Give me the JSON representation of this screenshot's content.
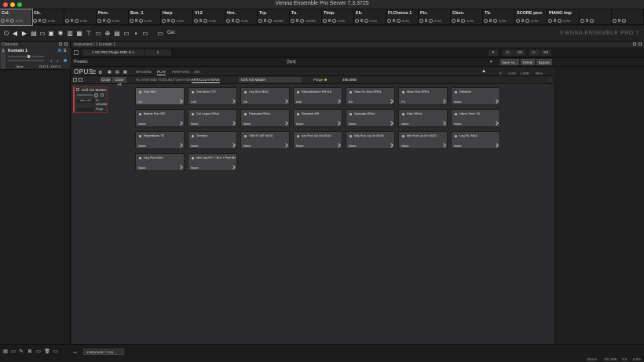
{
  "window": {
    "title": "Vienna Ensemble Pro Server 7.3.3725"
  },
  "mixer": [
    {
      "name": "Cel.",
      "val": "0.0%"
    },
    {
      "name": "Cb.",
      "val": "0.0%"
    },
    {
      "name": "",
      "val": "0.0%"
    },
    {
      "name": "Perc.",
      "val": "0.0%"
    },
    {
      "name": "Bsn. 1",
      "val": "0.0%"
    },
    {
      "name": "Harp",
      "val": "0.0%"
    },
    {
      "name": "Vl.2",
      "val": "0.0%"
    },
    {
      "name": "Hrn.",
      "val": "0.0%"
    },
    {
      "name": "Trp.",
      "val": "100/0R"
    },
    {
      "name": "Tu.",
      "val": "100/0R"
    },
    {
      "name": "Timp.",
      "val": "0.0%"
    },
    {
      "name": "Eh.",
      "val": "0.0%"
    },
    {
      "name": "Fl.Chorus 1",
      "val": "0.0%"
    },
    {
      "name": "Pic.",
      "val": "0.0%"
    },
    {
      "name": "Cbsn.",
      "val": "0.0%"
    },
    {
      "name": "Tb.",
      "val": "0.0%"
    },
    {
      "name": "SCORE perc",
      "val": "0.0%"
    },
    {
      "name": "PIANO imp",
      "val": "0.0%"
    },
    {
      "name": "",
      "val": ""
    },
    {
      "name": "",
      "val": ""
    }
  ],
  "toolbar": {
    "instance_name": "Cel.",
    "brand": "VIENNA ENSEMBLE PRO 7"
  },
  "channels": {
    "header": "Channels",
    "channel": {
      "name": "Kontakt 1",
      "m": "M",
      "s": "S",
      "v1": "1",
      "v2": "1",
      "in": "Opus",
      "out": "OUT 1 / OUT 2"
    }
  },
  "instrument": {
    "header": "Instrument / 1 Kontakt 1",
    "midi_label": "1 VE PRO Plugin MIDI in 1",
    "midi_ch": "1",
    "right_vals": [
      "0",
      "C-",
      "C0",
      "C-",
      "G9"
    ],
    "presets_label": "Presets:",
    "preset_value": "[Syx]",
    "save_as": "Save As...",
    "delete": "Delete",
    "bypass": "Bypass"
  },
  "opus": {
    "logo": "OPUS",
    "tabs": [
      "BROWSE",
      "PLAY",
      "PERFORM",
      "MIX"
    ],
    "active_tab": "PLAY",
    "subtabs": [
      "PLAYER",
      "MIDI TOOLS",
      "AUTOMATION",
      "ARTICULATIONS"
    ],
    "active_subtab": "ARTICULATIONS",
    "patch_name": "Cell. KS Master",
    "close": "Close",
    "close_all": "Close All",
    "purge": "Purge",
    "mem": "495.8MB",
    "voices": [
      "0",
      "1.0%",
      "1,408",
      "99.5"
    ],
    "instrument_label": "Cell. KS Master",
    "inst_vals": [
      "Vox 1 & 2",
      "Pn",
      "495.8MB",
      "Purge"
    ]
  },
  "articulations": [
    {
      "name": "Sus Vibr",
      "trigger": "C0"
    },
    {
      "name": "Sus Marc LTE",
      "trigger": "C#0"
    },
    {
      "name": "Leg Slur MAX",
      "trigger": "D0"
    },
    {
      "name": "Staccatissimo RRx16",
      "trigger": "D#0"
    },
    {
      "name": "Stac On Bow RRx4",
      "trigger": "E0"
    },
    {
      "name": "Marc Shrt RRx4",
      "trigger": "F0"
    },
    {
      "name": "Detache",
      "trigger": "None"
    },
    {
      "name": "Bartok Pizz RR",
      "trigger": "None"
    },
    {
      "name": "Col Legno RRx4",
      "trigger": "None"
    },
    {
      "name": "Pizzicato RRx4",
      "trigger": "None"
    },
    {
      "name": "Ricochet RR",
      "trigger": "None"
    },
    {
      "name": "Spiccato RRx4",
      "trigger": "None"
    },
    {
      "name": "Stac RRx4",
      "trigger": "None"
    },
    {
      "name": "Harm Trem TE",
      "trigger": "None"
    },
    {
      "name": "Repetitions TE",
      "trigger": "None"
    },
    {
      "name": "Tremolo",
      "trigger": "None"
    },
    {
      "name": "Trill HT WT MOD",
      "trigger": "None"
    },
    {
      "name": "Aro Run Up Dn MOD",
      "trigger": "None"
    },
    {
      "name": "Maj Run Up Dn MOD",
      "trigger": "None"
    },
    {
      "name": "Min Run Up Dn MOD",
      "trigger": "None"
    },
    {
      "name": "Leg RC MAX",
      "trigger": "None"
    },
    {
      "name": "Leg Port MAX",
      "trigger": "None"
    },
    {
      "name": "Mel Leg RC + Bur + Port MAX",
      "trigger": "None"
    }
  ],
  "bottom": {
    "tab_label": "Instrument / 1 Ko...",
    "stereo": "Stereo",
    "rate": "101.999",
    "v": "0.0",
    "pct": "6.0%"
  },
  "colors": {
    "accent": "#c03a3a",
    "selected_tile": "#5a5a5d",
    "tile": "#424245"
  }
}
